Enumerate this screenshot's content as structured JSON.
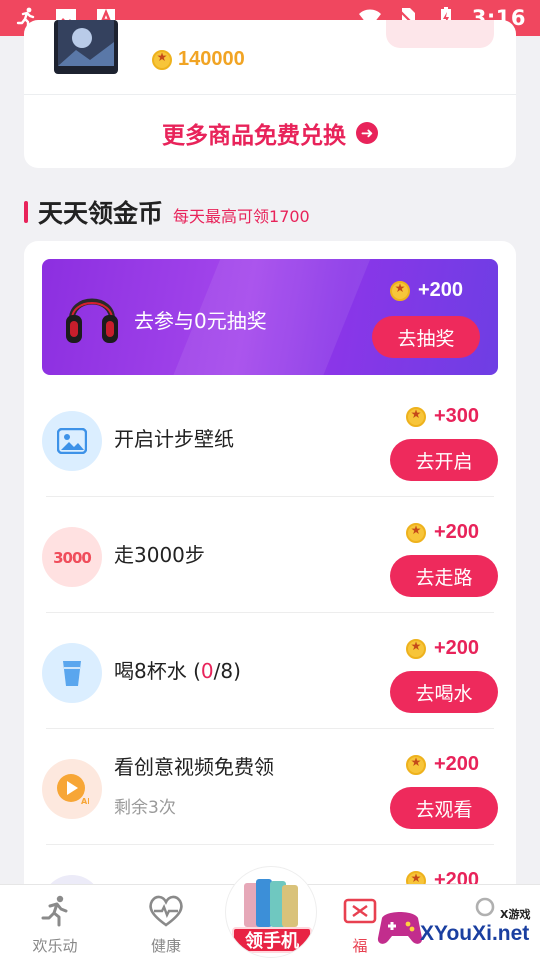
{
  "status_bar": {
    "time": "3:16",
    "left_icons": [
      "running-icon",
      "image-icon",
      "font-a-icon"
    ],
    "right_icons": [
      "wifi-icon",
      "no-sim-icon",
      "battery-charging-icon"
    ]
  },
  "featured_product": {
    "price": "140000",
    "more_link": "更多商品免费兑换"
  },
  "coins_section": {
    "title": "天天领金币",
    "subtitle": "每天最高可领1700"
  },
  "banner": {
    "text": "去参与0元抽奖",
    "reward": "+200",
    "button": "去抽奖"
  },
  "tasks": [
    {
      "title": "开启计步壁纸",
      "reward": "+300",
      "button": "去开启",
      "icon": "wallpaper-icon"
    },
    {
      "title": "走3000步",
      "reward": "+200",
      "button": "去走路",
      "icon": "steps-3000-icon"
    },
    {
      "title_prefix": "喝8杯水 (",
      "title_count": "0",
      "title_suffix": "/8)",
      "reward": "+200",
      "button": "去喝水",
      "icon": "water-cup-icon"
    },
    {
      "title": "看创意视频免费领",
      "note": "剩余3次",
      "reward": "+200",
      "button": "去观看",
      "icon": "video-ad-icon"
    },
    {
      "reward": "+200"
    }
  ],
  "tabbar": {
    "tabs": [
      {
        "label": "欢乐动",
        "icon": "runner-icon"
      },
      {
        "label": "健康",
        "icon": "heart-pulse-icon"
      },
      {
        "label": "领手机",
        "icon": "phones-icon"
      },
      {
        "label": "福",
        "icon": "ticket-icon"
      },
      {
        "icon": "profile-icon"
      }
    ],
    "accent": "#e82444"
  },
  "watermark": {
    "top": "X游戏",
    "text": "XYouXi.net"
  },
  "colors": {
    "status_bar": "#f0475f",
    "accent": "#e8235a",
    "button": "#ee2a5c",
    "coin": "#f7c53a",
    "banner_start": "#8c2fe0",
    "banner_end": "#6e3ee4"
  }
}
